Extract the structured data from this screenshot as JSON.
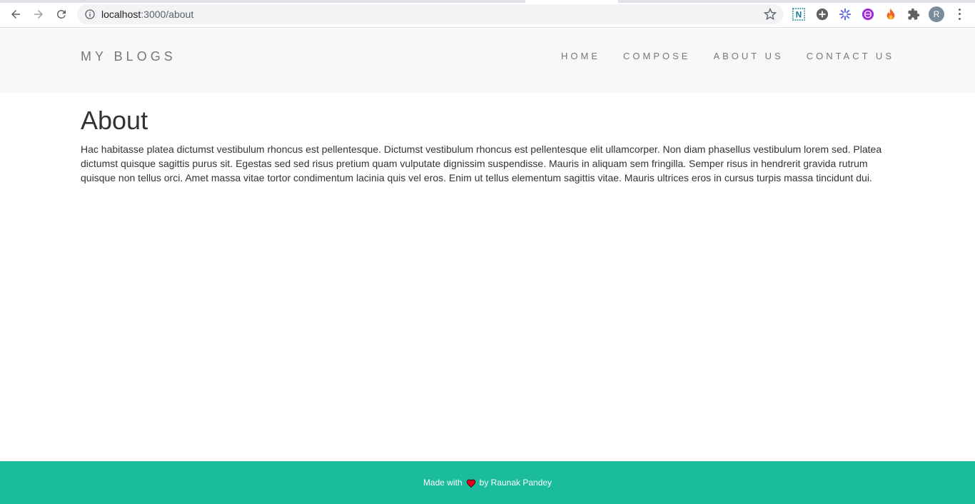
{
  "browser": {
    "url_host": "localhost",
    "url_rest": ":3000/about",
    "avatar_letter": "R",
    "extensions": [
      "n-extension-icon",
      "plus-circle-icon",
      "gear-flower-icon",
      "globe-icon",
      "fire-icon",
      "puzzle-icon"
    ]
  },
  "navbar": {
    "brand": "MY BLOGS",
    "links": [
      "HOME",
      "COMPOSE",
      "ABOUT US",
      "CONTACT US"
    ]
  },
  "content": {
    "title": "About",
    "body": "Hac habitasse platea dictumst vestibulum rhoncus est pellentesque. Dictumst vestibulum rhoncus est pellentesque elit ullamcorper. Non diam phasellus vestibulum lorem sed. Platea dictumst quisque sagittis purus sit. Egestas sed sed risus pretium quam vulputate dignissim suspendisse. Mauris in aliquam sem fringilla. Semper risus in hendrerit gravida rutrum quisque non tellus orci. Amet massa vitae tortor condimentum lacinia quis vel eros. Enim ut tellus elementum sagittis vitae. Mauris ultrices eros in cursus turpis massa tincidunt dui."
  },
  "footer": {
    "made_with": "Made with",
    "by": "by Raunak Pandey"
  },
  "colors": {
    "footer_bg": "#1abc9c",
    "navbar_bg": "#f8f8f8",
    "heart": "#e0001b"
  }
}
